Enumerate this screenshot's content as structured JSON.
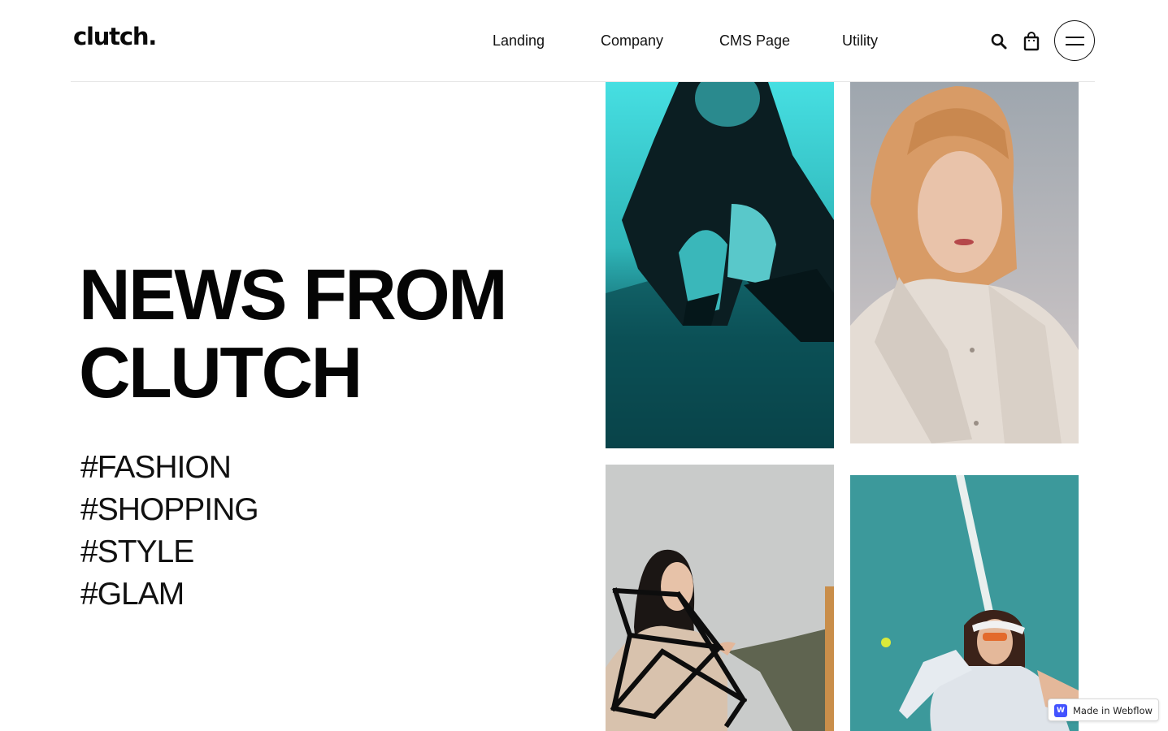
{
  "brand": {
    "logo_text": "clutch."
  },
  "nav": {
    "links": [
      {
        "label": "Landing"
      },
      {
        "label": "Company"
      },
      {
        "label": "CMS Page"
      },
      {
        "label": "Utility"
      }
    ],
    "icons": [
      "search-icon",
      "shopping-bag-icon",
      "menu-icon"
    ]
  },
  "hero": {
    "title_line1": "NEWS FROM",
    "title_line2": "CLUTCH",
    "tags": [
      "#FASHION",
      "#SHOPPING",
      "#STYLE",
      "#GLAM"
    ]
  },
  "gallery": {
    "photos": [
      {
        "description": "woman-in-leather-coat-teal-background"
      },
      {
        "description": "woman-with-blonde-bob-beige-jacket"
      },
      {
        "description": "women-with-geometric-frame"
      },
      {
        "description": "woman-on-tennis-court-with-visor"
      }
    ]
  },
  "badge": {
    "label": "Made in Webflow",
    "logo_letter": "W"
  },
  "colors": {
    "text": "#050505",
    "accent_teal": "#3fd6d8",
    "court_teal": "#3a9c9e",
    "webflow_blue": "#4353ff"
  }
}
